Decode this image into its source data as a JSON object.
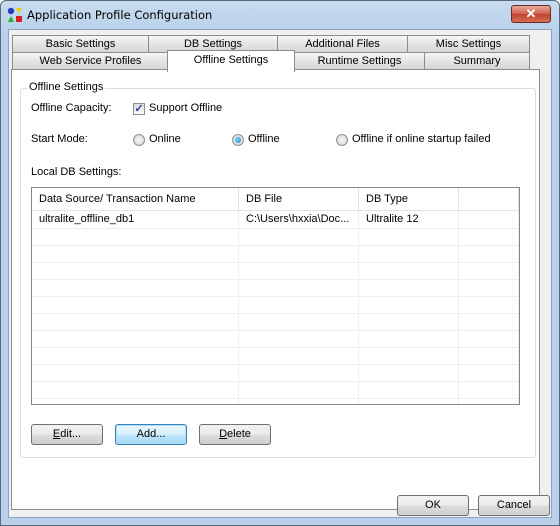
{
  "window": {
    "title": "Application Profile Configuration",
    "close_label": "✕"
  },
  "tabs": {
    "row1": [
      {
        "label": "Basic Settings"
      },
      {
        "label": "DB Settings"
      },
      {
        "label": "Additional Files"
      },
      {
        "label": "Misc Settings"
      }
    ],
    "row2": [
      {
        "label": "Web Service Profiles"
      },
      {
        "label": "Offline Settings",
        "active": true
      },
      {
        "label": "Runtime Settings"
      },
      {
        "label": "Summary"
      }
    ]
  },
  "offline": {
    "group_title": "Offline Settings",
    "capacity_label": "Offline Capacity:",
    "support_offline_label": "Support Offline",
    "support_offline_checked": true,
    "start_mode_label": "Start Mode:",
    "start_modes": [
      {
        "label": "Online",
        "selected": false
      },
      {
        "label": "Offline",
        "selected": true
      },
      {
        "label": "Offline if online startup failed",
        "selected": false
      }
    ],
    "local_db_label": "Local DB Settings:"
  },
  "table": {
    "columns": [
      "Data Source/ Transaction Name",
      "DB File",
      "DB Type",
      ""
    ],
    "rows": [
      [
        "ultralite_offline_db1",
        "C:\\Users\\hxxia\\Doc...",
        "Ultralite 12",
        ""
      ]
    ]
  },
  "actions": {
    "edit_label_u": "E",
    "edit_label_rest": "dit...",
    "add_label": "Add...",
    "delete_label_u": "D",
    "delete_label_rest": "elete"
  },
  "footer": {
    "ok_label": "OK",
    "cancel_label": "Cancel"
  }
}
